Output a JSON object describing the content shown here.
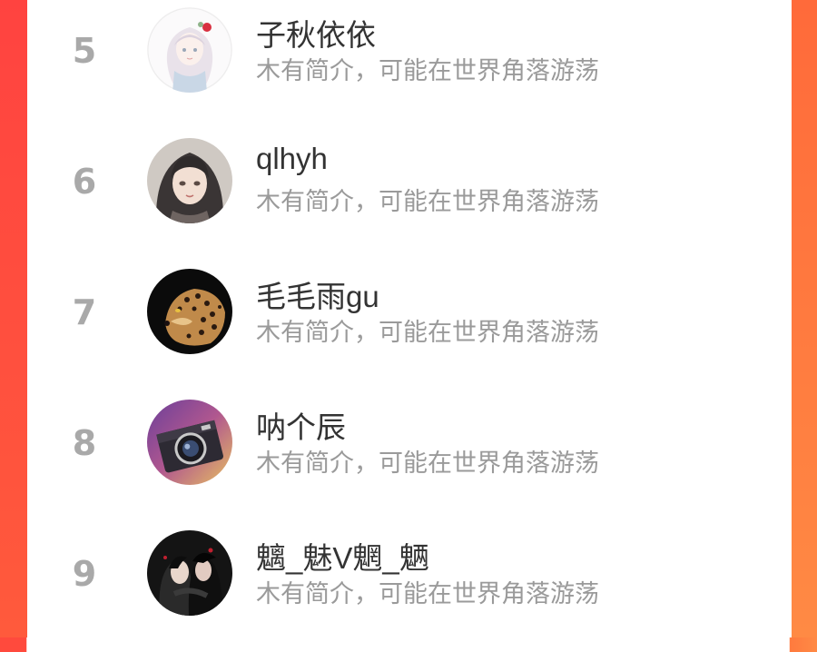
{
  "ranking": {
    "items": [
      {
        "rank": "5",
        "name": "子秋依依",
        "bio": "木有简介，可能在世界角落游荡",
        "avatar_icon": "avatar-anime-girl-icon"
      },
      {
        "rank": "6",
        "name": "qlhyh",
        "bio": "木有简介，可能在世界角落游荡",
        "avatar_icon": "avatar-portrait-girl-icon"
      },
      {
        "rank": "7",
        "name": "毛毛雨gu",
        "bio": "木有简介，可能在世界角落游荡",
        "avatar_icon": "avatar-leopard-icon"
      },
      {
        "rank": "8",
        "name": "呐个辰",
        "bio": "木有简介，可能在世界角落游荡",
        "avatar_icon": "avatar-camera-icon"
      },
      {
        "rank": "9",
        "name": "魑_魅V魍_魉",
        "bio": "木有简介，可能在世界角落游荡",
        "avatar_icon": "avatar-couple-icon"
      }
    ]
  },
  "colors": {
    "frame_left": "#ff4a3d",
    "frame_right": "#ff8a45",
    "rank_gray": "#a9a9a9",
    "name_text": "#333333",
    "bio_text": "#9a9a9a"
  }
}
